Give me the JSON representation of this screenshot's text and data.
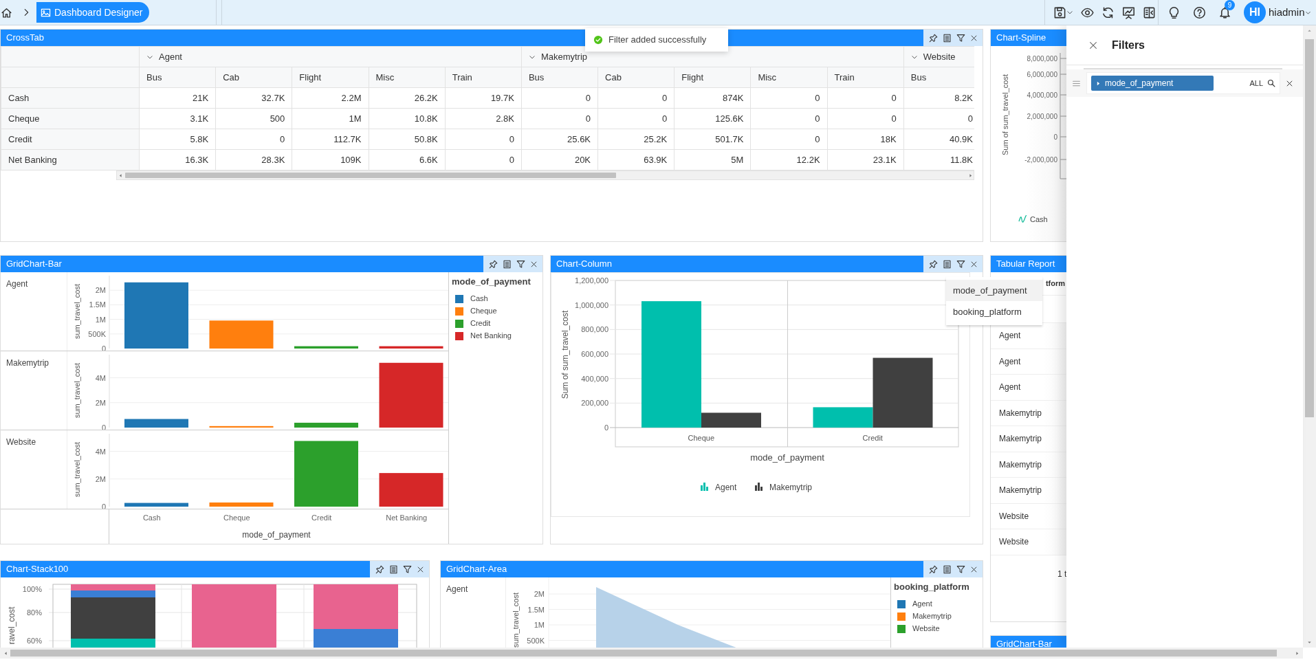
{
  "topbar": {
    "breadcrumb": "Dashboard Designer",
    "notification_count": "9",
    "avatar_initials": "HI",
    "user": "hiadmin"
  },
  "toast": {
    "message": "Filter added successfully"
  },
  "crosstab": {
    "title": "CrossTab",
    "groups": [
      {
        "label": "Agent",
        "expanded": true,
        "columns": [
          "Bus",
          "Cab",
          "Flight",
          "Misc",
          "Train"
        ]
      },
      {
        "label": "Makemytrip",
        "expanded": true,
        "columns": [
          "Bus",
          "Cab",
          "Flight",
          "Misc",
          "Train"
        ]
      },
      {
        "label": "Website",
        "expanded": true,
        "columns": [
          "Bus"
        ]
      }
    ],
    "rows": [
      {
        "label": "Cash",
        "cells": [
          "21K",
          "32.7K",
          "2.2M",
          "26.2K",
          "19.7K",
          "0",
          "0",
          "874K",
          "0",
          "0",
          "8.2K"
        ]
      },
      {
        "label": "Cheque",
        "cells": [
          "3.1K",
          "500",
          "1M",
          "10.8K",
          "2.8K",
          "0",
          "0",
          "125.6K",
          "0",
          "0",
          "0"
        ]
      },
      {
        "label": "Credit",
        "cells": [
          "5.8K",
          "0",
          "112.7K",
          "50.8K",
          "0",
          "25.6K",
          "25.2K",
          "501.7K",
          "0",
          "18K",
          "40.9K"
        ]
      },
      {
        "label": "Net Banking",
        "cells": [
          "16.3K",
          "28.3K",
          "109K",
          "6.6K",
          "0",
          "20K",
          "63.9K",
          "5M",
          "12.2K",
          "23.1K",
          "11.8K"
        ]
      }
    ]
  },
  "chart_spline": {
    "title": "Chart-Spline",
    "ylabel": "Sum of sum_travel_cost",
    "yticks": [
      "8,000,000",
      "6,000,000",
      "4,000,000",
      "2,000,000",
      "0",
      "-2,000,000"
    ],
    "legend": [
      "Cash"
    ]
  },
  "gridchart_bar": {
    "title": "GridChart-Bar",
    "legend_title": "mode_of_payment",
    "legend": [
      {
        "label": "Cash",
        "color": "#1f77b4"
      },
      {
        "label": "Cheque",
        "color": "#ff7f0e"
      },
      {
        "label": "Credit",
        "color": "#2ca02c"
      },
      {
        "label": "Net Banking",
        "color": "#d62728"
      }
    ],
    "rows": [
      {
        "label": "Agent",
        "chart_data": {
          "type": "bar",
          "ylabel": "sum_travel_cost",
          "grid": "y",
          "values": [
            2270000,
            960000,
            80000,
            80000
          ],
          "ylim": [
            0,
            2500000
          ],
          "yticks": [
            {
              "value": 0,
              "label": "0"
            },
            {
              "value": 500000,
              "label": "500K"
            },
            {
              "value": 1000000,
              "label": "1M"
            },
            {
              "value": 1500000,
              "label": "1.5M"
            },
            {
              "value": 2000000,
              "label": "2M"
            }
          ]
        }
      },
      {
        "label": "Makemytrip",
        "chart_data": {
          "type": "bar",
          "ylabel": "sum_travel_cost",
          "grid": "y",
          "values": [
            690000,
            120000,
            390000,
            5200000
          ],
          "ylim": [
            0,
            5850000
          ],
          "yticks": [
            {
              "value": 0,
              "label": "0"
            },
            {
              "value": 2000000,
              "label": "2M"
            },
            {
              "value": 4000000,
              "label": "4M"
            }
          ]
        }
      },
      {
        "label": "Website",
        "chart_data": {
          "type": "bar",
          "ylabel": "sum_travel_cost",
          "xlabel": "mode_of_payment",
          "categories": [
            "Cash",
            "Cheque",
            "Credit",
            "Net Banking"
          ],
          "grid": "y",
          "values": [
            270000,
            300000,
            4750000,
            2430000
          ],
          "ylim": [
            0,
            5270000
          ],
          "yticks": [
            {
              "value": 0,
              "label": "0"
            },
            {
              "value": 2000000,
              "label": "2M"
            },
            {
              "value": 4000000,
              "label": "4M"
            }
          ]
        }
      }
    ]
  },
  "chart_column": {
    "title": "Chart-Column",
    "chart_data": {
      "type": "bar",
      "xlabel": "mode_of_payment",
      "ylabel": "Sum of sum_travel_cost",
      "categories": [
        "Cheque",
        "Credit"
      ],
      "series": [
        {
          "name": "Agent",
          "color": "#00bfad",
          "values": [
            1031000,
            166000
          ]
        },
        {
          "name": "Makemytrip",
          "color": "#404040",
          "values": [
            121000,
            569000
          ]
        }
      ],
      "grid": "y",
      "legend": true,
      "ylim": [
        0,
        1200000
      ],
      "yticks": [
        {
          "value": 0,
          "label": "0"
        },
        {
          "value": 200000,
          "label": "200,000"
        },
        {
          "value": 400000,
          "label": "400,000"
        },
        {
          "value": 600000,
          "label": "600,000"
        },
        {
          "value": 800000,
          "label": "800,000"
        },
        {
          "value": 1000000,
          "label": "1,000,000"
        },
        {
          "value": 1200000,
          "label": "1,200,000"
        }
      ]
    }
  },
  "filter_menu": {
    "items": [
      {
        "label": "mode_of_payment",
        "selected": true
      },
      {
        "label": "booking_platform",
        "selected": false
      }
    ]
  },
  "tabular_report": {
    "title": "Tabular Report",
    "column_header": "tform",
    "rows": [
      "Agent",
      "Agent",
      "Agent",
      "Makemytrip",
      "Makemytrip",
      "Makemytrip",
      "Makemytrip",
      "Website",
      "Website"
    ],
    "pagination": "1 t"
  },
  "chart_stack100": {
    "title": "Chart-Stack100",
    "ylabel": "ravel_cost",
    "yticks": [
      "100%",
      "80%",
      "60%"
    ]
  },
  "gridchart_area": {
    "title": "GridChart-Area",
    "rows": [
      {
        "label": "Agent",
        "ylabel": "sum_travel_cost",
        "yticks": [
          "2M",
          "1.5M",
          "1M",
          "500K"
        ]
      }
    ],
    "legend_title": "booking_platform",
    "legend": [
      {
        "label": "Agent",
        "color": "#1f77b4"
      },
      {
        "label": "Makemytrip",
        "color": "#ff7f0e"
      },
      {
        "label": "Website",
        "color": "#2ca02c"
      }
    ]
  },
  "gridchart_bar_2": {
    "title": "GridChart-Bar"
  },
  "filters_panel": {
    "title": "Filters",
    "filters": [
      {
        "field": "mode_of_payment",
        "value": "ALL"
      }
    ]
  }
}
